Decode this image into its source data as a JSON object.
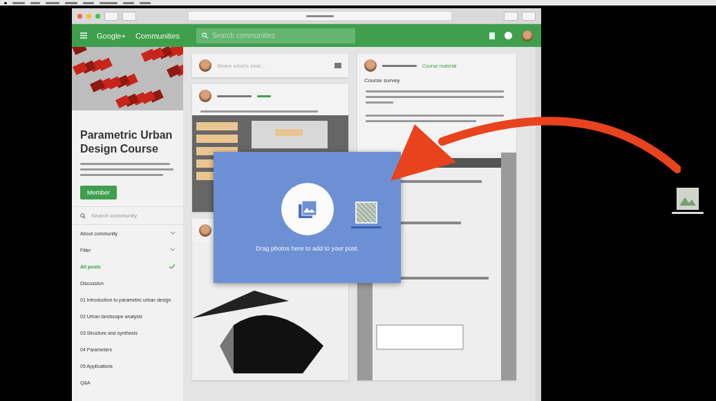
{
  "header": {
    "brand": "Google+",
    "section": "Communities",
    "search_placeholder": "Search communities"
  },
  "community": {
    "title": "Parametric Urban Design Course",
    "join_label": "Member",
    "search_placeholder": "Search community",
    "categories": [
      {
        "label": "About community",
        "kind": "expand",
        "selected": false
      },
      {
        "label": "Filter",
        "kind": "expand",
        "selected": false
      },
      {
        "label": "All posts",
        "kind": "item",
        "selected": true
      },
      {
        "label": "Discussion",
        "kind": "item",
        "selected": false
      },
      {
        "label": "01 Introduction to parametric urban design",
        "kind": "item",
        "selected": false
      },
      {
        "label": "02 Urban landscape analysis",
        "kind": "item",
        "selected": false
      },
      {
        "label": "03 Structure and synthesis",
        "kind": "item",
        "selected": false
      },
      {
        "label": "04 Parameters",
        "kind": "item",
        "selected": false
      },
      {
        "label": "05 Applications",
        "kind": "item",
        "selected": false
      },
      {
        "label": "Q&A",
        "kind": "item",
        "selected": false
      }
    ]
  },
  "share_box": {
    "placeholder": "Share what's new..."
  },
  "posts": [
    {
      "kind": "screenshot"
    },
    {
      "kind": "shape"
    }
  ],
  "right_post": {
    "category": "Course material",
    "heading": "Course survey"
  },
  "drop_dialog": {
    "message": "Drag photos here to add to your post."
  }
}
